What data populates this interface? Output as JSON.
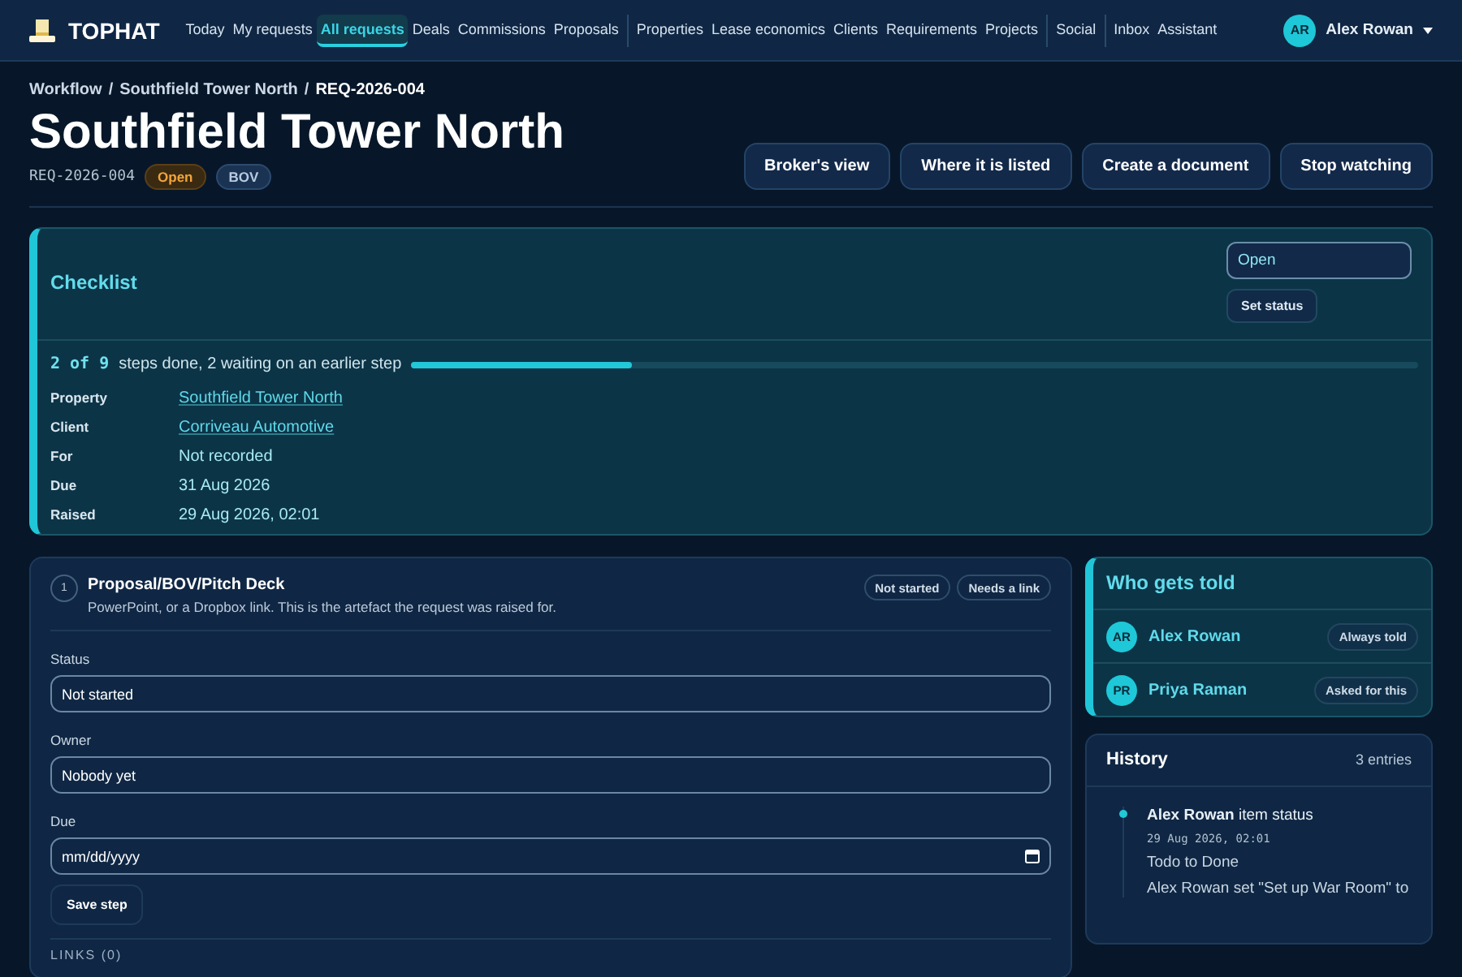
{
  "brand": {
    "name": "TOPHAT"
  },
  "nav": [
    [
      {
        "label": "Today",
        "selected": false
      },
      {
        "label": "My requests",
        "selected": false
      },
      {
        "label": "All requests",
        "selected": true
      },
      {
        "label": "Deals",
        "selected": false
      },
      {
        "label": "Commissions",
        "selected": false
      },
      {
        "label": "Proposals",
        "selected": false
      }
    ],
    [
      {
        "label": "Properties",
        "selected": false
      },
      {
        "label": "Lease economics",
        "selected": false
      },
      {
        "label": "Clients",
        "selected": false
      },
      {
        "label": "Requirements",
        "selected": false
      },
      {
        "label": "Projects",
        "selected": false
      }
    ],
    [
      {
        "label": "Social",
        "selected": false
      }
    ],
    [
      {
        "label": "Inbox",
        "selected": false
      },
      {
        "label": "Assistant",
        "selected": false
      }
    ]
  ],
  "user": {
    "initials": "AR",
    "name": "Alex Rowan"
  },
  "breadcrumb": [
    "Workflow",
    "Southfield Tower North",
    "REQ-2026-004"
  ],
  "breadcrumb_separator": "/",
  "title": "Southfield Tower North",
  "ref": "REQ-2026-004",
  "tags": [
    {
      "label": "Open",
      "kind": "status"
    },
    {
      "label": "BOV",
      "kind": "type"
    }
  ],
  "actions": [
    "Broker's view",
    "Where it is listed",
    "Create a document",
    "Stop watching"
  ],
  "checklist": {
    "title": "Checklist",
    "status_value": "Open",
    "set_status": "Set status",
    "count": "2 of 9",
    "summary": "steps done, 2 waiting on an earlier step",
    "level": 0.22,
    "facts": [
      {
        "label": "Property",
        "value": "Southfield Tower North",
        "kind": "link"
      },
      {
        "label": "Client",
        "value": "Corriveau Automotive",
        "kind": "link"
      },
      {
        "label": "For",
        "value": "Not recorded",
        "kind": "text"
      },
      {
        "label": "Due",
        "value": "31 Aug 2026",
        "kind": "text"
      },
      {
        "label": "Raised",
        "value": "29 Aug 2026, 02:01",
        "kind": "text"
      }
    ]
  },
  "step": {
    "number": "1",
    "title": "Proposal/BOV/Pitch Deck",
    "description": "PowerPoint, or a Dropbox link. This is the artefact the request was raised for.",
    "badges": [
      "Not started",
      "Needs a link"
    ],
    "fields": [
      {
        "label": "Status",
        "value": "Not started",
        "kind": "text"
      },
      {
        "label": "Owner",
        "value": "Nobody yet",
        "kind": "text"
      },
      {
        "label": "Due",
        "placeholder": "mm/dd/yyyy",
        "kind": "date"
      }
    ],
    "save": "Save step",
    "links_heading": "LINKS (0)"
  },
  "watchers": {
    "title": "Who gets told",
    "people": [
      {
        "initials": "AR",
        "name": "Alex Rowan",
        "reason": "Always told"
      },
      {
        "initials": "PR",
        "name": "Priya Raman",
        "reason": "Asked for this"
      }
    ]
  },
  "history": {
    "title": "History",
    "count": "3 entries",
    "entries": [
      {
        "headline": "**Alex Rowan** item status",
        "time": "29 Aug 2026, 02:01",
        "lines": [
          "Todo to Done",
          "Alex Rowan set \"Set up War Room\" to"
        ]
      }
    ]
  }
}
